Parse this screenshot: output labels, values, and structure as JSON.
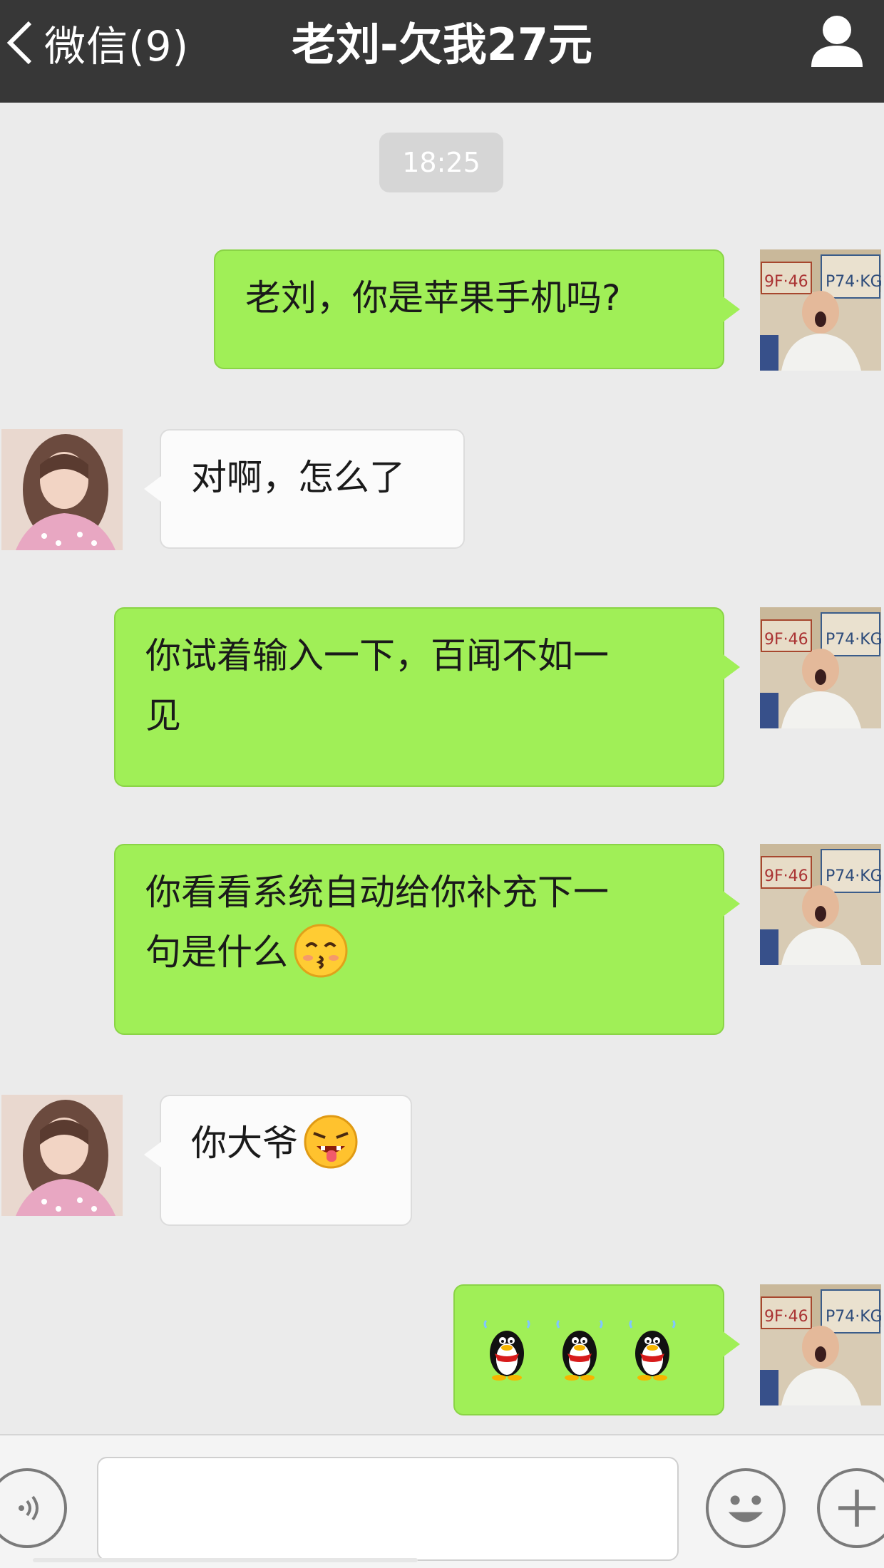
{
  "header": {
    "back_label": "微信(9)",
    "title": "老刘-欠我27元"
  },
  "chat": {
    "timestamp": "18:25",
    "messages": [
      {
        "from": "me",
        "text": "老刘，你是苹果手机吗?"
      },
      {
        "from": "other",
        "text": "对啊，怎么了"
      },
      {
        "from": "me",
        "text_line1": "你试着输入一下，百闻不如一",
        "text_line2": "见"
      },
      {
        "from": "me",
        "text_line1": "你看看系统自动给你补充下一",
        "text_line2": "句是什么",
        "emoji": "kissing-face-icon"
      },
      {
        "from": "other",
        "text": "你大爷",
        "emoji": "tongue-out-angry-face-icon"
      },
      {
        "from": "me",
        "emojis": [
          "qq-penguin-icon",
          "qq-penguin-icon",
          "qq-penguin-icon"
        ]
      }
    ]
  },
  "colors": {
    "navbar": "#373737",
    "my_bubble": "#a0ef57",
    "other_bubble": "#fbfbfb",
    "background": "#ebebeb"
  },
  "input_bar": {
    "input_value": "",
    "icons": [
      "voice-icon",
      "emoji-icon",
      "plus-icon"
    ]
  }
}
